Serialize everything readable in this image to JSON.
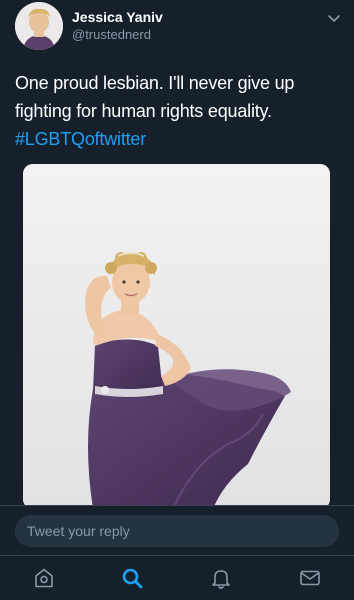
{
  "tweet": {
    "author": {
      "display_name": "Jessica Yaniv",
      "handle": "@trustednerd"
    },
    "text": "One proud lesbian. I'll never give up fighting for human rights equality.",
    "hashtag": "#LGBTQoftwitter",
    "photo_icon": "photo-person-purple-dress"
  },
  "reply": {
    "placeholder": "Tweet your reply"
  },
  "nav": {
    "items": [
      {
        "name": "home",
        "icon": "home-icon"
      },
      {
        "name": "search",
        "icon": "search-icon",
        "active": true
      },
      {
        "name": "notifications",
        "icon": "bell-icon"
      },
      {
        "name": "messages",
        "icon": "mail-icon"
      }
    ]
  },
  "colors": {
    "background": "#15202b",
    "accent": "#1da1f2",
    "secondary_text": "#8899a6",
    "divider": "#38444d"
  }
}
